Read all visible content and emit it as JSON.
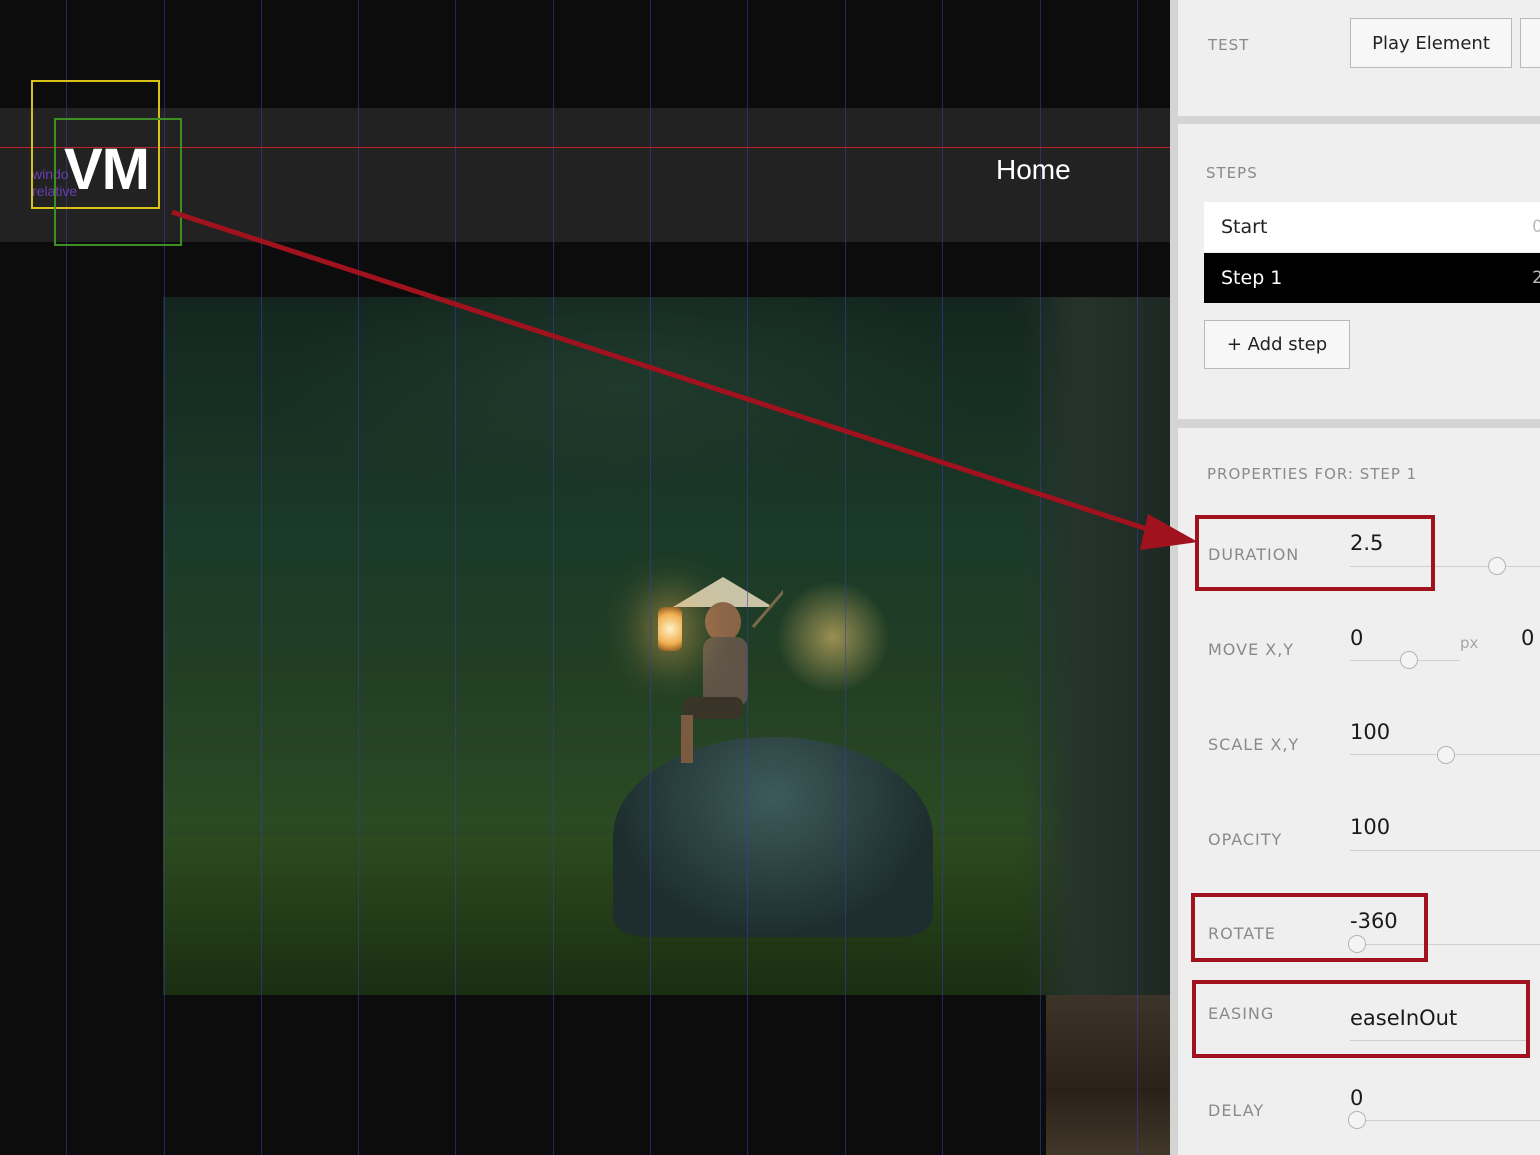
{
  "canvas": {
    "logo_text": "VM",
    "logo_caption_line1": "windo",
    "logo_caption_line2": "relative",
    "nav_home": "Home"
  },
  "panel": {
    "test": {
      "label": "TEST",
      "play_button": "Play Element"
    },
    "steps": {
      "label": "STEPS",
      "items": [
        {
          "label": "Start",
          "value": "0"
        },
        {
          "label": "Step 1",
          "value": "2"
        }
      ],
      "selected": "Step 1",
      "add_button": "+ Add step"
    },
    "properties": {
      "header": "PROPERTIES FOR: STEP 1",
      "duration": {
        "label": "DURATION",
        "value": "2.5"
      },
      "move": {
        "label": "MOVE X,Y",
        "x": "0",
        "unit": "px",
        "y": "0"
      },
      "scale": {
        "label": "SCALE X,Y",
        "value": "100"
      },
      "opacity": {
        "label": "OPACITY",
        "value": "100"
      },
      "rotate": {
        "label": "ROTATE",
        "value": "-360"
      },
      "easing": {
        "label": "EASING",
        "value": "easeInOut"
      },
      "delay": {
        "label": "DELAY",
        "value": "0"
      }
    }
  },
  "colors": {
    "highlight_red": "#a0121e",
    "selected_step_bg": "#000000",
    "logo_box_yellow": "#d8c21a",
    "logo_box_green": "#3e8f21"
  }
}
